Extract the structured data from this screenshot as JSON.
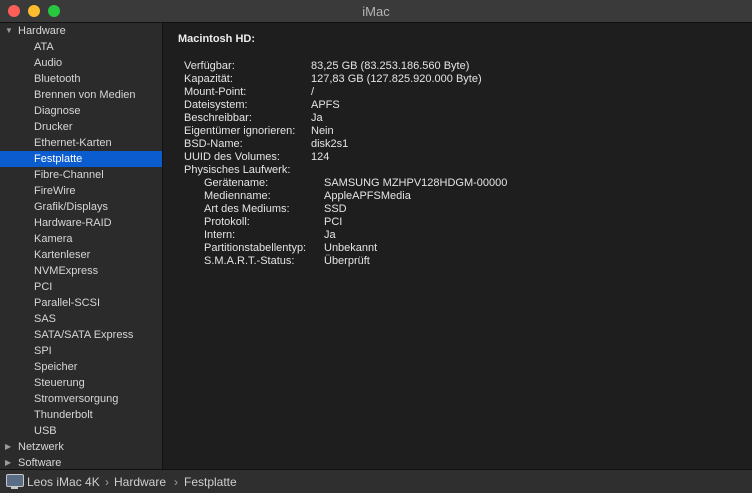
{
  "window": {
    "title": "iMac"
  },
  "sidebar": {
    "hardware": {
      "label": "Hardware",
      "items": [
        "ATA",
        "Audio",
        "Bluetooth",
        "Brennen von Medien",
        "Diagnose",
        "Drucker",
        "Ethernet-Karten",
        "Festplatte",
        "Fibre-Channel",
        "FireWire",
        "Grafik/Displays",
        "Hardware-RAID",
        "Kamera",
        "Kartenleser",
        "NVMExpress",
        "PCI",
        "Parallel-SCSI",
        "SAS",
        "SATA/SATA Express",
        "SPI",
        "Speicher",
        "Steuerung",
        "Stromversorgung",
        "Thunderbolt",
        "USB"
      ],
      "selected": "Festplatte"
    },
    "netzwerk": {
      "label": "Netzwerk"
    },
    "software": {
      "label": "Software"
    }
  },
  "detail": {
    "volume_title": "Macintosh HD:",
    "fields": [
      {
        "label": "Verfügbar:",
        "value": "83,25 GB (83.253.186.560 Byte)"
      },
      {
        "label": "Kapazität:",
        "value": "127,83 GB (127.825.920.000 Byte)"
      },
      {
        "label": "Mount-Point:",
        "value": "/"
      },
      {
        "label": "Dateisystem:",
        "value": "APFS"
      },
      {
        "label": "Beschreibbar:",
        "value": "Ja"
      },
      {
        "label": "Eigentümer ignorieren:",
        "value": "Nein"
      },
      {
        "label": "BSD-Name:",
        "value": "disk2s1"
      },
      {
        "label": "UUID des Volumes:",
        "value": "124"
      }
    ],
    "physical": {
      "label": "Physisches Laufwerk:",
      "fields": [
        {
          "label": "Gerätename:",
          "value": "SAMSUNG MZHPV128HDGM-00000"
        },
        {
          "label": "Medienname:",
          "value": "AppleAPFSMedia"
        },
        {
          "label": "Art des Mediums:",
          "value": "SSD"
        },
        {
          "label": "Protokoll:",
          "value": "PCI"
        },
        {
          "label": "Intern:",
          "value": "Ja"
        },
        {
          "label": "Partitionstabellentyp:",
          "value": "Unbekannt"
        },
        {
          "label": "S.M.A.R.T.-Status:",
          "value": "Überprüft"
        }
      ]
    }
  },
  "statusbar": {
    "icon": "imac-icon",
    "path": [
      "Leos iMac 4K",
      "Hardware",
      "Festplatte"
    ],
    "separator": "›"
  },
  "colors": {
    "selection": "#0a5ccf",
    "close": "#fc5f57",
    "minimize": "#fdbc2e",
    "zoom": "#28c840"
  }
}
